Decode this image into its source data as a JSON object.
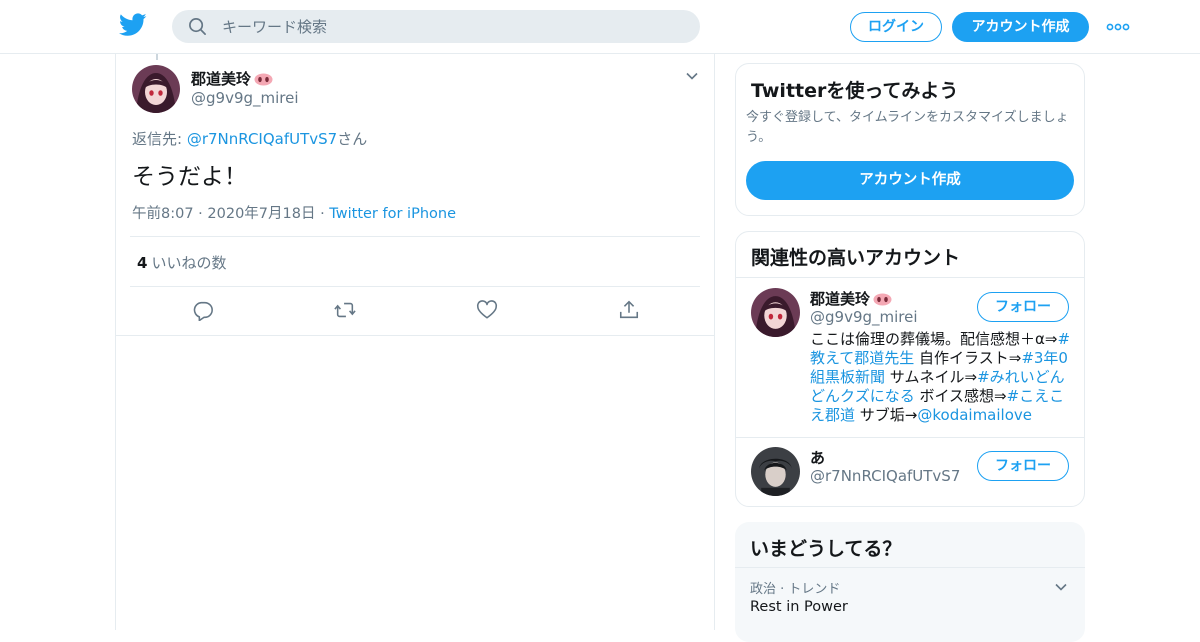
{
  "header": {
    "search_placeholder": "キーワード検索",
    "login_label": "ログイン",
    "signup_label": "アカウント作成",
    "logo_icon": "twitter-bird-icon",
    "more_icon": "more-dots-icon",
    "accent_color": "#1da1f2"
  },
  "tweet": {
    "author_name": "郡道美玲",
    "author_handle": "@g9v9g_mirei",
    "reply_prefix": "返信先: ",
    "reply_to": "@r7NnRCIQafUTvS7",
    "reply_suffix": "さん",
    "text": "そうだよ！",
    "time": "午前8:07",
    "date": "2020年7月18日",
    "source": "Twitter for iPhone",
    "like_count": "4",
    "like_label": "いいねの数",
    "action_icons": [
      "reply-icon",
      "retweet-icon",
      "like-heart-icon",
      "share-icon"
    ]
  },
  "signup_card": {
    "title": "Twitterを使ってみよう",
    "description": "今すぐ登録して、タイムラインをカスタマイズしましょう。",
    "button_label": "アカウント作成"
  },
  "related": {
    "title": "関連性の高いアカウント",
    "accounts": [
      {
        "name": "郡道美玲",
        "handle": "@g9v9g_mirei",
        "follow_label": "フォロー",
        "bio_parts": [
          {
            "text": "ここは倫理の葬儀場。配信感想＋α⇒",
            "link": false
          },
          {
            "text": "#教えて郡道先生",
            "link": true
          },
          {
            "text": " 自作イラスト⇒",
            "link": false
          },
          {
            "text": "#3年0組黒板新聞",
            "link": true
          },
          {
            "text": " サムネイル⇒",
            "link": false
          },
          {
            "text": "#みれいどんどんクズになる",
            "link": true
          },
          {
            "text": " ボイス感想⇒",
            "link": false
          },
          {
            "text": "#こえこえ郡道",
            "link": true
          },
          {
            "text": " サブ垢→",
            "link": false
          },
          {
            "text": "@kodaimailove",
            "link": true
          }
        ]
      },
      {
        "name": "あ",
        "handle": "@r7NnRCIQafUTvS7",
        "follow_label": "フォロー"
      }
    ]
  },
  "trends": {
    "title": "いまどうしてる？",
    "items": [
      {
        "meta": "政治 · トレンド",
        "name": "Rest in Power"
      }
    ]
  }
}
